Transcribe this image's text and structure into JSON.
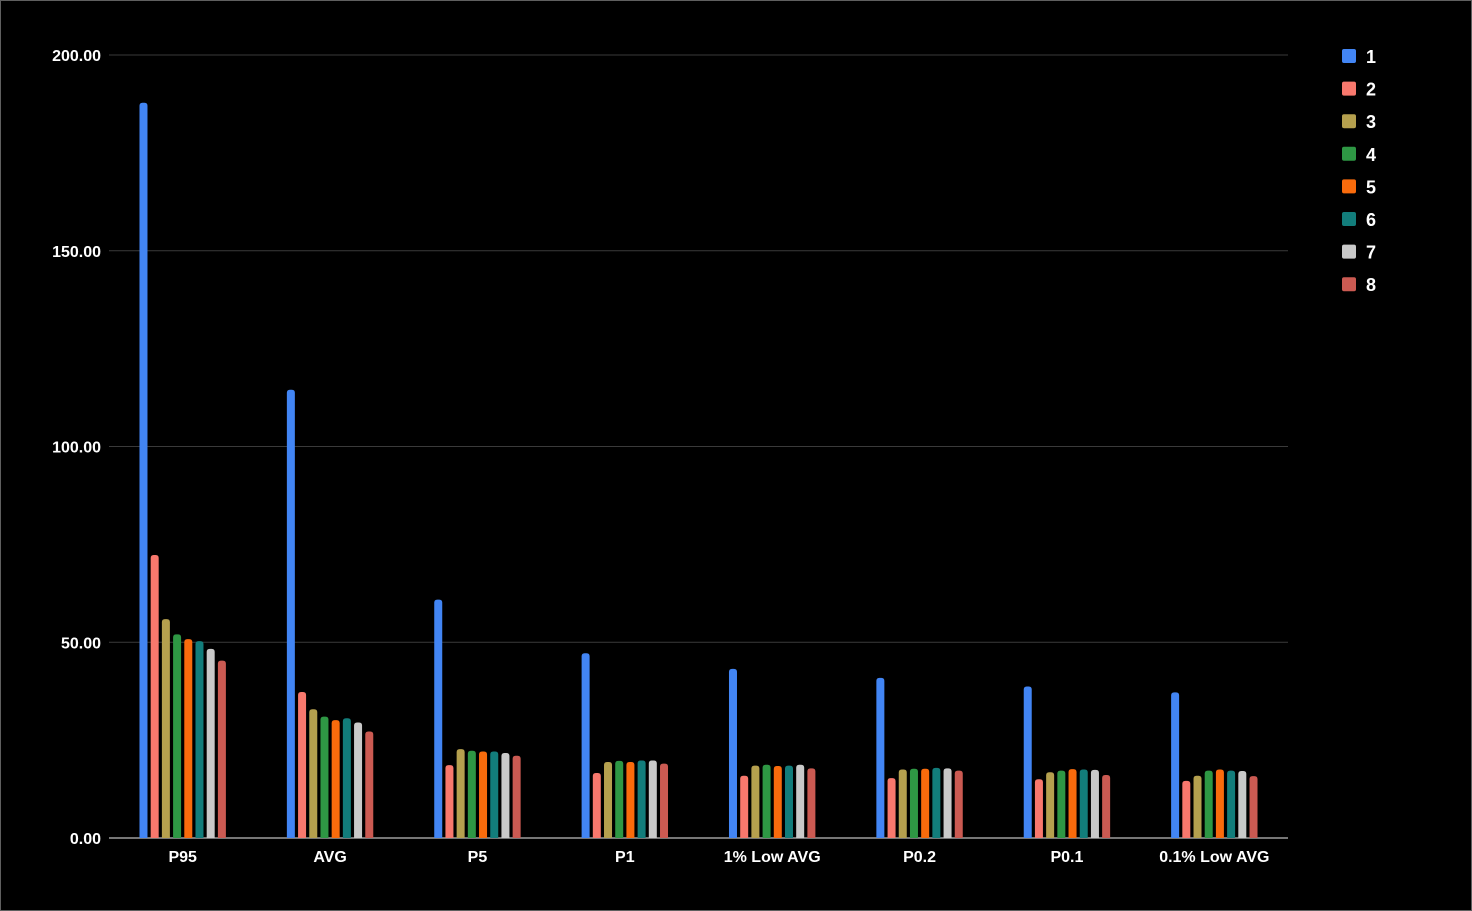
{
  "chart_data": {
    "type": "bar",
    "title": "",
    "xlabel": "",
    "ylabel": "",
    "ylim": [
      0,
      200
    ],
    "y_ticks": [
      "0.00",
      "50.00",
      "100.00",
      "150.00",
      "200.00"
    ],
    "y_tick_values": [
      0,
      50,
      100,
      150,
      200
    ],
    "grid": true,
    "legend_position": "right",
    "categories": [
      "P95",
      "AVG",
      "P5",
      "P1",
      "1% Low AVG",
      "P0.2",
      "P0.1",
      "0.1% Low AVG"
    ],
    "series": [
      {
        "name": "1",
        "color": "#4285f4",
        "values": [
          187.8,
          114.5,
          60.9,
          47.2,
          43.2,
          40.9,
          38.7,
          37.2
        ]
      },
      {
        "name": "2",
        "color": "#f8786d",
        "values": [
          72.3,
          37.3,
          18.6,
          16.6,
          15.9,
          15.3,
          15.0,
          14.6
        ]
      },
      {
        "name": "3",
        "color": "#b5a04e",
        "values": [
          55.9,
          32.9,
          22.7,
          19.4,
          18.5,
          17.5,
          16.8,
          15.9
        ]
      },
      {
        "name": "4",
        "color": "#2e9744",
        "values": [
          52.0,
          31.0,
          22.3,
          19.7,
          18.7,
          17.7,
          17.2,
          17.2
        ]
      },
      {
        "name": "5",
        "color": "#f96b0c",
        "values": [
          50.8,
          30.1,
          22.1,
          19.4,
          18.4,
          17.7,
          17.6,
          17.5
        ]
      },
      {
        "name": "6",
        "color": "#127d7b",
        "values": [
          50.3,
          30.6,
          22.1,
          19.8,
          18.5,
          17.9,
          17.5,
          17.2
        ]
      },
      {
        "name": "7",
        "color": "#c9c9c9",
        "values": [
          48.3,
          29.5,
          21.7,
          19.8,
          18.7,
          17.8,
          17.4,
          17.1
        ]
      },
      {
        "name": "8",
        "color": "#cb5a52",
        "values": [
          45.3,
          27.2,
          21.0,
          19.0,
          17.8,
          17.2,
          16.1,
          15.8
        ]
      }
    ]
  }
}
